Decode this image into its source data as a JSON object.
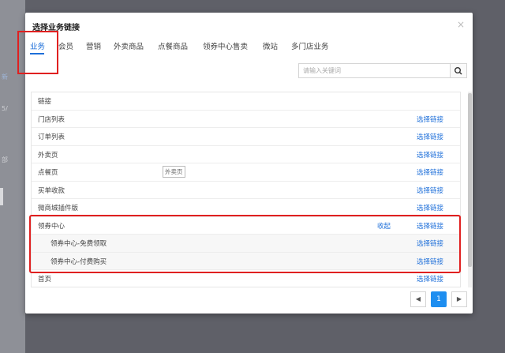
{
  "background": {
    "fragments": [
      "新",
      "5/",
      "部"
    ]
  },
  "modal": {
    "title": "选择业务链接",
    "close": "×",
    "tabs": [
      "业务",
      "会员",
      "营销",
      "外卖商品",
      "点餐商品",
      "领券中心售卖",
      "微站",
      "多门店业务"
    ],
    "active_tab": 0,
    "search": {
      "placeholder": "请输入关键词",
      "value": ""
    },
    "table": {
      "header": "链接",
      "rows": [
        {
          "label": "门店列表",
          "action": "选择链接"
        },
        {
          "label": "订单列表",
          "action": "选择链接"
        },
        {
          "label": "外卖页",
          "action": "选择链接"
        },
        {
          "label": "点餐页",
          "action": "选择链接",
          "tooltip": "外卖页"
        },
        {
          "label": "买单收款",
          "action": "选择链接"
        },
        {
          "label": "微商城插件版",
          "action": "选择链接"
        },
        {
          "label": "领券中心",
          "action": "选择链接",
          "toggle": "收起"
        },
        {
          "label": "领券中心-免费领取",
          "action": "选择链接",
          "sub": true
        },
        {
          "label": "领券中心-付费购买",
          "action": "选择链接",
          "sub": true
        },
        {
          "label": "首页",
          "action": "选择链接"
        }
      ]
    },
    "pagination": {
      "prev": "◀",
      "current": "1",
      "next": "▶"
    }
  },
  "colors": {
    "accent": "#1e6fd9",
    "highlight": "#e02020",
    "page_active": "#1e8ef0"
  }
}
